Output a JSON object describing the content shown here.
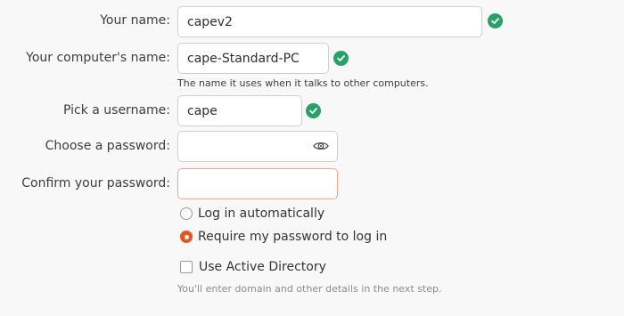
{
  "form": {
    "name": {
      "label": "Your name:",
      "value": "capev2",
      "valid_icon": "check-circle-icon"
    },
    "computer_name": {
      "label": "Your computer's name:",
      "value": "cape-Standard-PC",
      "valid_icon": "check-circle-icon",
      "hint": "The name it uses when it talks to other computers."
    },
    "username": {
      "label": "Pick a username:",
      "value": "cape",
      "valid_icon": "check-circle-icon"
    },
    "password": {
      "label": "Choose a password:",
      "value": "",
      "reveal_icon": "eye-icon"
    },
    "confirm_password": {
      "label": "Confirm your password:",
      "value": ""
    },
    "login_options": [
      {
        "label": "Log in automatically",
        "selected": false
      },
      {
        "label": "Require my password to log in",
        "selected": true
      }
    ],
    "active_directory": {
      "label": "Use Active Directory",
      "checked": false,
      "hint": "You'll enter domain and other details in the next step."
    }
  },
  "colors": {
    "accent": "#e95420",
    "valid": "#26a269",
    "error_border": "#f0a48d"
  }
}
